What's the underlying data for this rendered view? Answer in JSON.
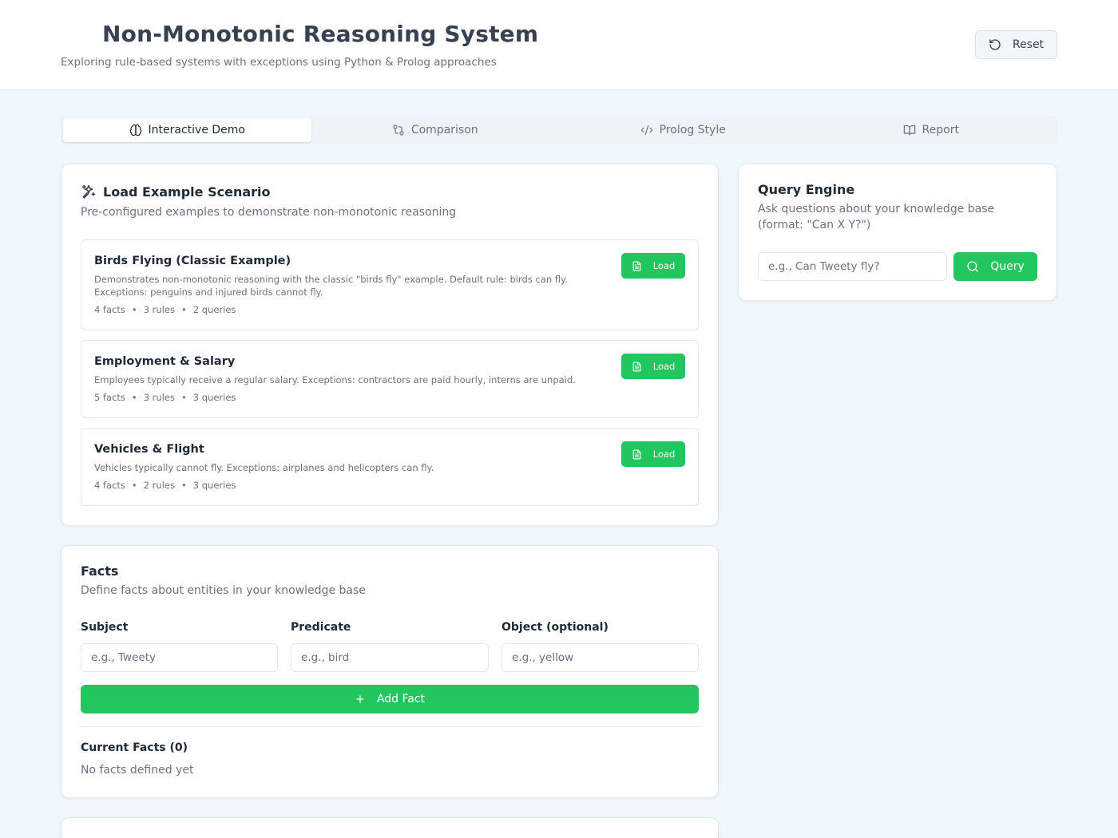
{
  "header": {
    "title": "Non-Monotonic Reasoning System",
    "subtitle": "Exploring rule-based systems with exceptions using Python & Prolog approaches",
    "reset_label": "Reset"
  },
  "tabs": [
    {
      "label": "Interactive Demo",
      "icon": "brain-icon",
      "active": true
    },
    {
      "label": "Comparison",
      "icon": "git-compare-icon",
      "active": false
    },
    {
      "label": "Prolog Style",
      "icon": "code-icon",
      "active": false
    },
    {
      "label": "Report",
      "icon": "book-open-icon",
      "active": false
    }
  ],
  "scenarios_card": {
    "title": "Load Example Scenario",
    "description": "Pre-configured examples to demonstrate non-monotonic reasoning",
    "load_label": "Load",
    "items": [
      {
        "title": "Birds Flying (Classic Example)",
        "description": "Demonstrates non-monotonic reasoning with the classic \"birds fly\" example. Default rule: birds can fly. Exceptions: penguins and injured birds cannot fly.",
        "facts": "4 facts",
        "rules": "3 rules",
        "queries": "2 queries"
      },
      {
        "title": "Employment & Salary",
        "description": "Employees typically receive a regular salary. Exceptions: contractors are paid hourly, interns are unpaid.",
        "facts": "5 facts",
        "rules": "3 rules",
        "queries": "3 queries"
      },
      {
        "title": "Vehicles & Flight",
        "description": "Vehicles typically cannot fly. Exceptions: airplanes and helicopters can fly.",
        "facts": "4 facts",
        "rules": "2 rules",
        "queries": "3 queries"
      }
    ],
    "separator": "•"
  },
  "facts_card": {
    "title": "Facts",
    "description": "Define facts about entities in your knowledge base",
    "subject_label": "Subject",
    "subject_placeholder": "e.g., Tweety",
    "predicate_label": "Predicate",
    "predicate_placeholder": "e.g., bird",
    "object_label": "Object (optional)",
    "object_placeholder": "e.g., yellow",
    "add_label": "Add Fact",
    "current_label": "Current Facts (0)",
    "empty_text": "No facts defined yet"
  },
  "query_card": {
    "title": "Query Engine",
    "description": "Ask questions about your knowledge base (format: \"Can X Y?\")",
    "placeholder": "e.g., Can Tweety fly?",
    "query_label": "Query"
  },
  "colors": {
    "accent": "#22c55e",
    "background": "#f0f7fd",
    "card": "#ffffff",
    "text": "#1f2937",
    "muted": "#6b7280"
  }
}
